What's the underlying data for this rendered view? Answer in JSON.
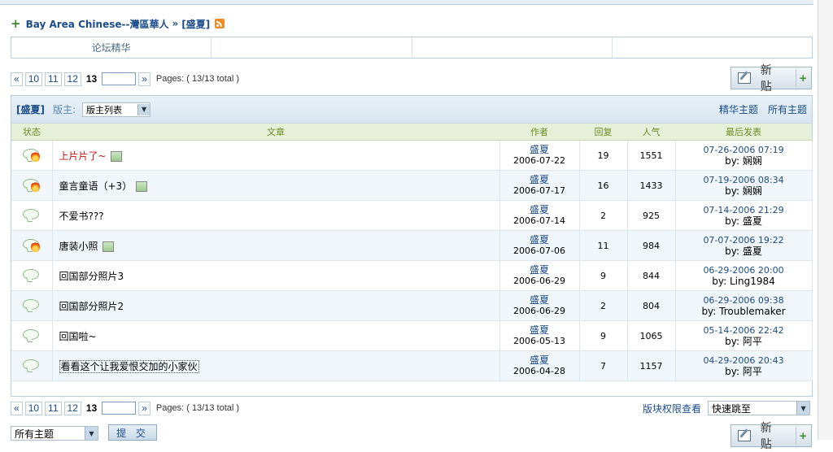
{
  "breadcrumb": {
    "forum_root": "Bay Area Chinese--灣區華人",
    "sep": "»",
    "current": "[盛夏]"
  },
  "nav": {
    "cells": [
      "论坛精华",
      "",
      "",
      ""
    ]
  },
  "pager": {
    "prev": "«",
    "pages": [
      "10",
      "11",
      "12"
    ],
    "current": "13",
    "next": "»",
    "info": "Pages: ( 13/13 total )",
    "goto_value": ""
  },
  "new_post": {
    "label": "新 贴",
    "plus": "+"
  },
  "forum_header": {
    "name": "[盛夏]",
    "moderators_label": "版主:",
    "moderators_select": "版主列表",
    "tab_digest": "精华主题",
    "tab_all": "所有主题"
  },
  "columns": {
    "status": "状态",
    "title": "文章",
    "author": "作者",
    "replies": "回复",
    "views": "人气",
    "last": "最后发表"
  },
  "threads": [
    {
      "status": "hot",
      "title": "上片片了~",
      "image": true,
      "red": true,
      "boxed": false,
      "author": "盛夏",
      "date": "2006-07-22",
      "replies": "19",
      "views": "1551",
      "last_time": "07-26-2006 07:19",
      "last_by": "by: 娴娴"
    },
    {
      "status": "hot",
      "title": "童言童语（+3）",
      "image": true,
      "red": false,
      "boxed": false,
      "author": "盛夏",
      "date": "2006-07-17",
      "replies": "16",
      "views": "1433",
      "last_time": "07-19-2006 08:34",
      "last_by": "by: 娴娴"
    },
    {
      "status": "normal",
      "title": "不爱书???",
      "image": false,
      "red": false,
      "boxed": false,
      "author": "盛夏",
      "date": "2006-07-14",
      "replies": "2",
      "views": "925",
      "last_time": "07-14-2006 21:29",
      "last_by": "by: 盛夏"
    },
    {
      "status": "hot",
      "title": "唐装小照",
      "image": true,
      "red": false,
      "boxed": false,
      "author": "盛夏",
      "date": "2006-07-06",
      "replies": "11",
      "views": "984",
      "last_time": "07-07-2006 19:22",
      "last_by": "by: 盛夏"
    },
    {
      "status": "normal",
      "title": "回国部分照片3",
      "image": false,
      "red": false,
      "boxed": false,
      "author": "盛夏",
      "date": "2006-06-29",
      "replies": "9",
      "views": "844",
      "last_time": "06-29-2006 20:00",
      "last_by": "by: Ling1984"
    },
    {
      "status": "normal",
      "title": "回国部分照片2",
      "image": false,
      "red": false,
      "boxed": false,
      "author": "盛夏",
      "date": "2006-06-29",
      "replies": "2",
      "views": "804",
      "last_time": "06-29-2006 09:38",
      "last_by": "by: Troublemaker"
    },
    {
      "status": "normal",
      "title": "回国啦~",
      "image": false,
      "red": false,
      "boxed": false,
      "author": "盛夏",
      "date": "2006-05-13",
      "replies": "9",
      "views": "1065",
      "last_time": "05-14-2006 22:42",
      "last_by": "by: 阿平"
    },
    {
      "status": "normal",
      "title": "看看这个让我爱恨交加的小家伙",
      "image": false,
      "red": false,
      "boxed": true,
      "author": "盛夏",
      "date": "2006-04-28",
      "replies": "7",
      "views": "1157",
      "last_time": "04-29-2006 20:43",
      "last_by": "by: 阿平"
    }
  ],
  "bottom": {
    "permissions_label": "版块权限查看",
    "jump_select": "快速跳至",
    "filter_select": "所有主题",
    "submit_label": "提 交"
  },
  "colors": {
    "link": "#1a4c8a",
    "hot_title": "#cc1111",
    "column_header": "#6b8e23",
    "border": "#b9cfe0"
  }
}
